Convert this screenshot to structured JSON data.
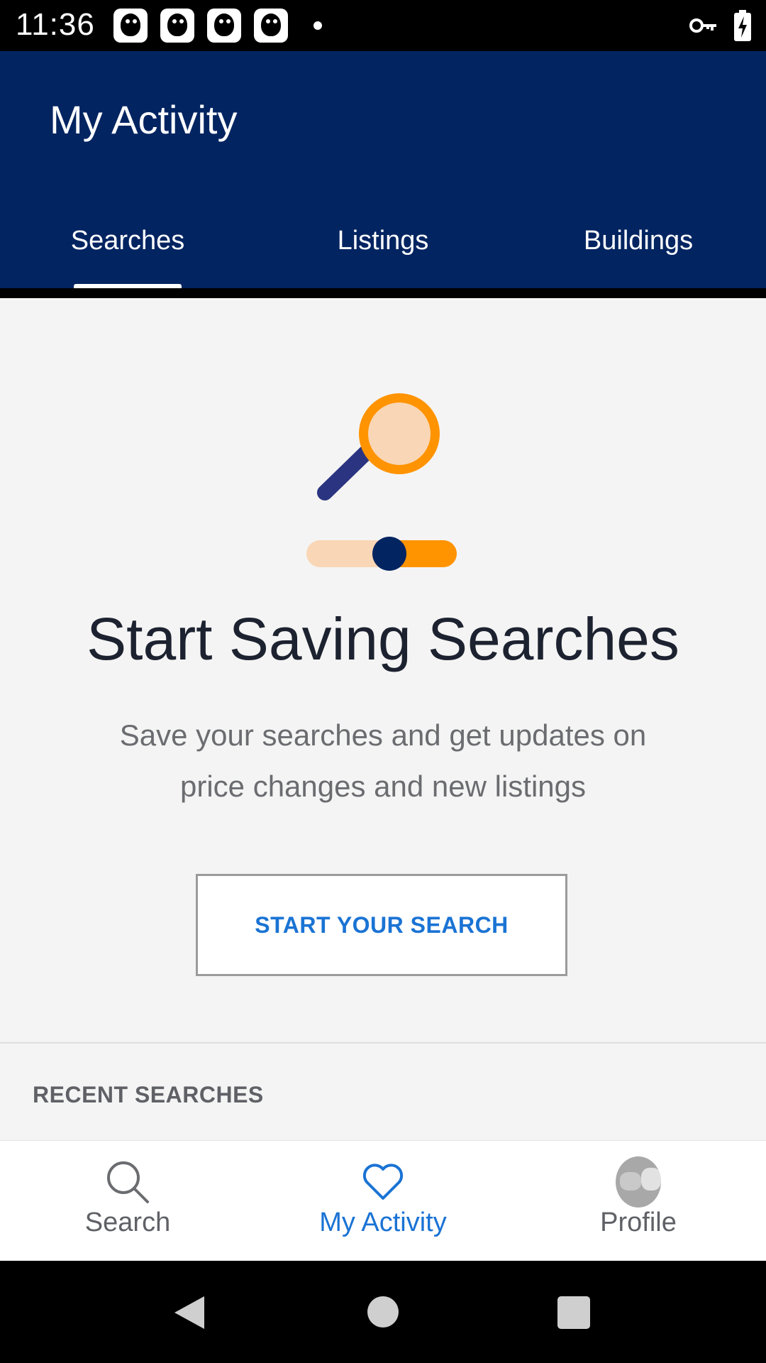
{
  "status_bar": {
    "time": "11:36",
    "notification_icons": [
      "app-notification-icon",
      "app-notification-icon",
      "app-notification-icon",
      "app-notification-icon"
    ],
    "right_icons": [
      "vpn-key-icon",
      "battery-charging-icon"
    ]
  },
  "app_bar": {
    "title": "My Activity",
    "tabs": [
      {
        "label": "Searches",
        "active": true
      },
      {
        "label": "Listings",
        "active": false
      },
      {
        "label": "Buildings",
        "active": false
      }
    ]
  },
  "empty_state": {
    "illustration": "search-slider-illustration",
    "headline": "Start Saving Searches",
    "subtext": "Save your searches and get updates on price changes and new listings",
    "cta_label": "START YOUR SEARCH"
  },
  "recent_searches": {
    "label": "RECENT SEARCHES"
  },
  "bottom_nav": {
    "items": [
      {
        "label": "Search",
        "icon": "search-icon",
        "active": false
      },
      {
        "label": "My Activity",
        "icon": "heart-icon",
        "active": true
      },
      {
        "label": "Profile",
        "icon": "avatar",
        "active": false
      }
    ]
  },
  "colors": {
    "header": "#022461",
    "accent": "#1a73d4",
    "illustration_orange": "#ff9300",
    "illustration_peach": "#f9d6b5",
    "background": "#f4f4f4"
  }
}
